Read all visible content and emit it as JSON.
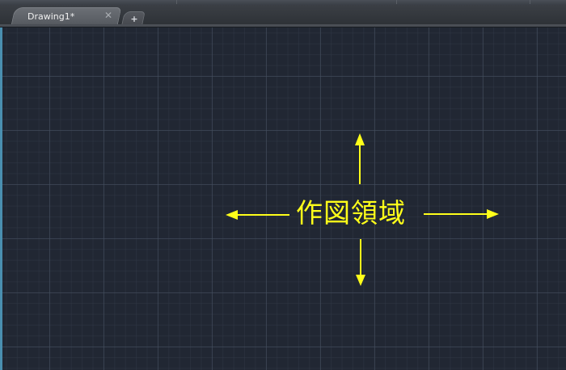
{
  "tabs": [
    {
      "label": "Drawing1*",
      "close_icon": "close-icon",
      "active": true
    }
  ],
  "new_tab": {
    "icon": "plus-icon"
  },
  "drawing_area": {
    "annotation": {
      "text": "作図領域",
      "color": "#ffff1a",
      "arrows": [
        "arrow-up-icon",
        "arrow-down-icon",
        "arrow-left-icon",
        "arrow-right-icon"
      ]
    },
    "background_color": "#212733",
    "grid": true
  }
}
